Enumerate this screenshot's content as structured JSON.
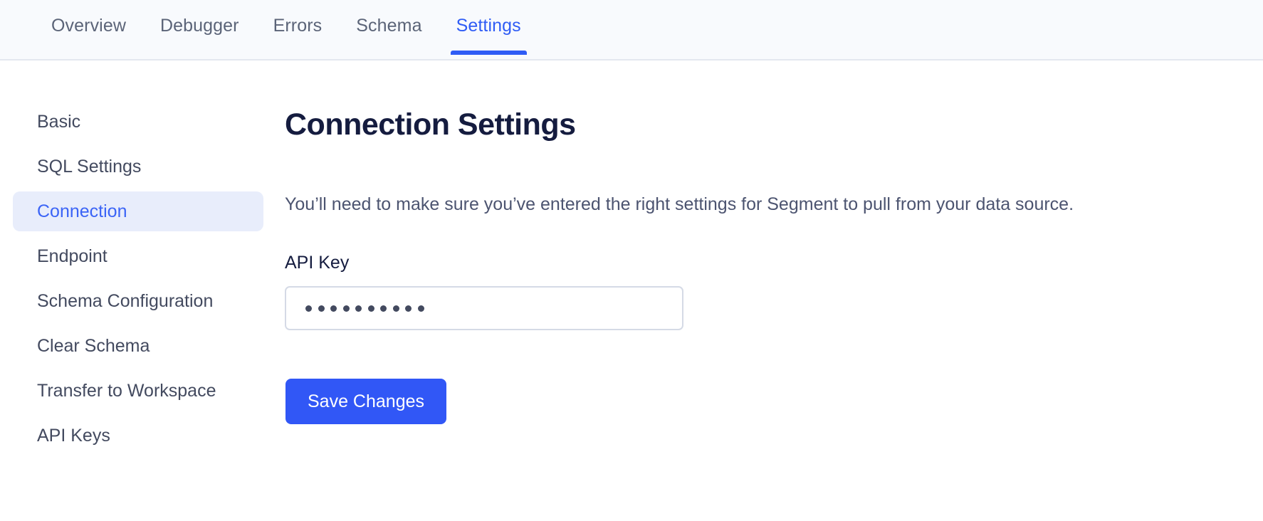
{
  "tabs": [
    {
      "label": "Overview",
      "active": false
    },
    {
      "label": "Debugger",
      "active": false
    },
    {
      "label": "Errors",
      "active": false
    },
    {
      "label": "Schema",
      "active": false
    },
    {
      "label": "Settings",
      "active": true
    }
  ],
  "sidebar": {
    "items": [
      {
        "label": "Basic",
        "active": false
      },
      {
        "label": "SQL Settings",
        "active": false
      },
      {
        "label": "Connection",
        "active": true
      },
      {
        "label": "Endpoint",
        "active": false
      },
      {
        "label": "Schema Configuration",
        "active": false
      },
      {
        "label": "Clear Schema",
        "active": false
      },
      {
        "label": "Transfer to Workspace",
        "active": false
      },
      {
        "label": "API Keys",
        "active": false
      }
    ]
  },
  "main": {
    "title": "Connection Settings",
    "description": "You’ll need to make sure you’ve entered the right settings for Segment to pull from your data source.",
    "api_key": {
      "label": "API Key",
      "masked_value": "••••••••••",
      "mask_dot_count": 10,
      "placeholder": ""
    },
    "save_label": "Save Changes"
  },
  "colors": {
    "accent": "#3157f6",
    "active_tab": "#2f5cf5",
    "sidebar_active_bg": "#e8edfb",
    "sidebar_active_text": "#3b64f6",
    "header_bg": "#f8fafd",
    "title": "#151c3f",
    "body_text": "#4c5470",
    "input_border": "#d5dae6"
  }
}
